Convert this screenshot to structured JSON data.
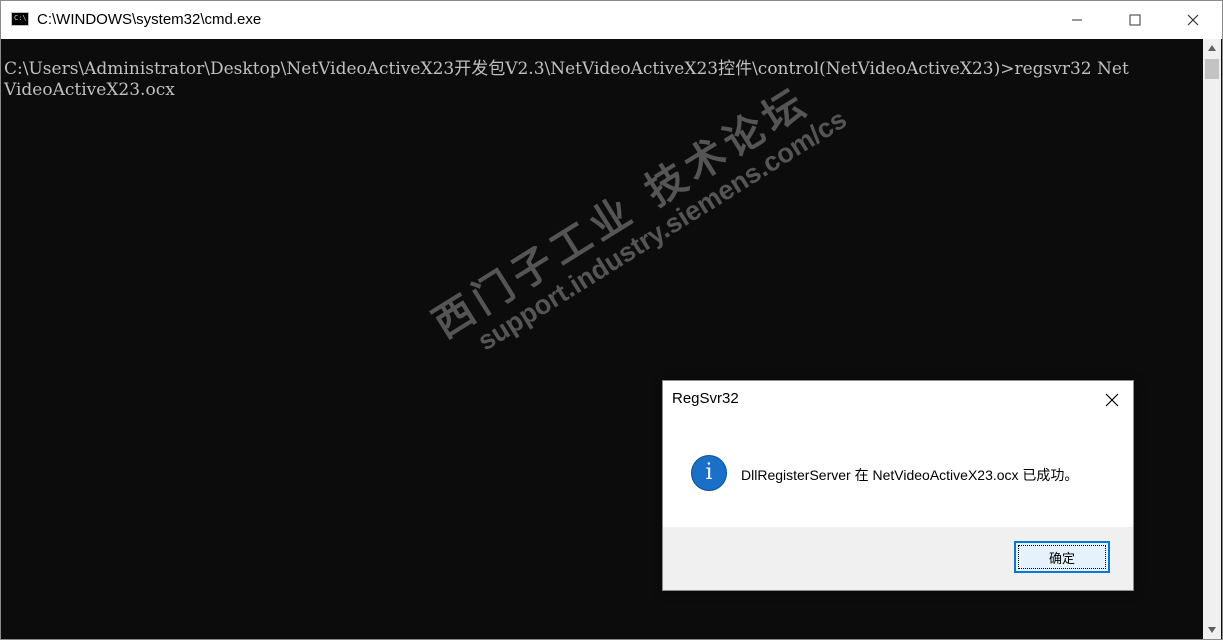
{
  "window": {
    "icon_label": "C:\\.",
    "title": "C:\\WINDOWS\\system32\\cmd.exe"
  },
  "console": {
    "lines": [
      "C:\\Users\\Administrator\\Desktop\\NetVideoActiveX23开发包V2.3\\NetVideoActiveX23控件\\control(NetVideoActiveX23)>regsvr32 Net",
      "VideoActiveX23.ocx"
    ]
  },
  "watermark": {
    "cn": "西门子工业 技术论坛",
    "url": "support.industry.siemens.com/cs"
  },
  "dialog": {
    "title": "RegSvr32",
    "icon_glyph": "i",
    "message": "DllRegisterServer 在 NetVideoActiveX23.ocx 已成功。",
    "ok_label": "确定"
  },
  "colors": {
    "console_bg": "#0c0c0c",
    "console_text": "#c0c0c0",
    "info_icon": "#1a70c8",
    "button_focus": "#0078d7"
  }
}
